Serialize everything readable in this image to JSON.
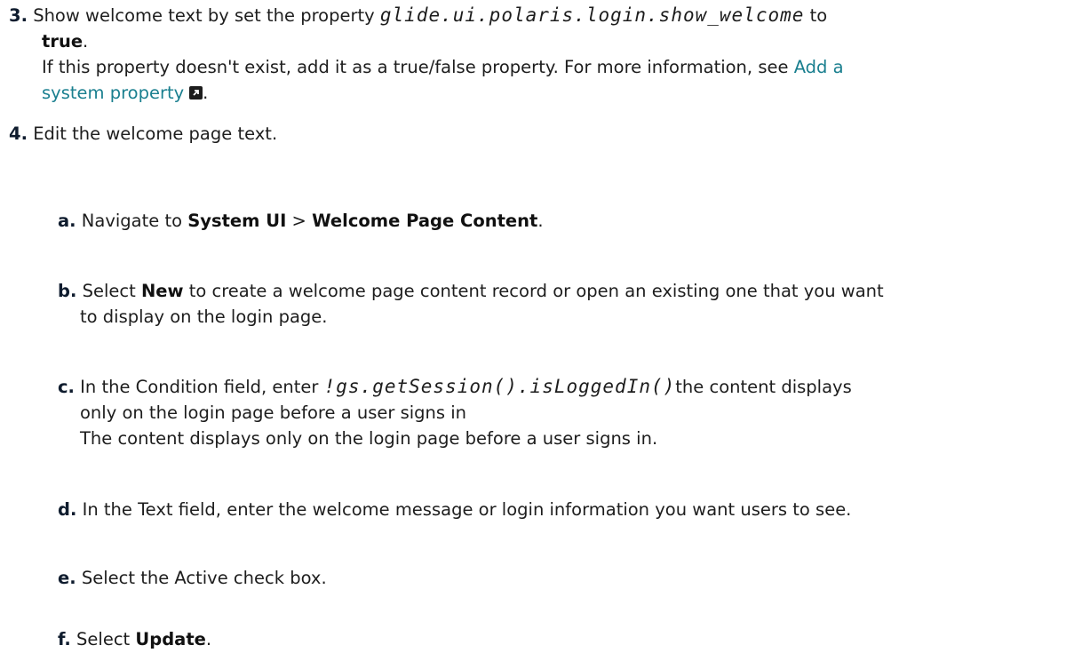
{
  "step3": {
    "num": "3.",
    "text_before": "Show welcome text by set the property",
    "property": "glide.ui.polaris.login.show_welcome",
    "text_to": "to",
    "value": "true",
    "period": ".",
    "note": "If this property doesn't exist, add it as a true/false property. For more information, see",
    "link_line1": "Add a",
    "link_line2": "system property",
    "link_period": ".",
    "link_icon": "external-link-icon"
  },
  "step4": {
    "num": "4.",
    "text": "Edit the welcome page text."
  },
  "sub_a": {
    "num": "a.",
    "text_before": "Navigate to",
    "menu1": "System UI",
    "sep": ">",
    "menu2": "Welcome Page Content",
    "period": "."
  },
  "sub_b": {
    "num": "b.",
    "text_before": "Select",
    "button": "New",
    "line1_after": "to create a welcome page content record or open an existing one that you want",
    "line2": "to display on the login page."
  },
  "sub_c": {
    "num": "c.",
    "text_before": "In the Condition field, enter",
    "code": "!gs.getSession().isLoggedIn()",
    "line1_after": "the content displays",
    "line2": "only on the login page before a user signs in",
    "line3": "The content displays only on the login page before a user signs in."
  },
  "sub_d": {
    "num": "d.",
    "text": "In the Text field, enter the welcome message or login information you want users to see."
  },
  "sub_e": {
    "num": "e.",
    "text": "Select the Active check box."
  },
  "sub_f": {
    "num": "f.",
    "text_before": "Select",
    "button": "Update",
    "period": "."
  }
}
